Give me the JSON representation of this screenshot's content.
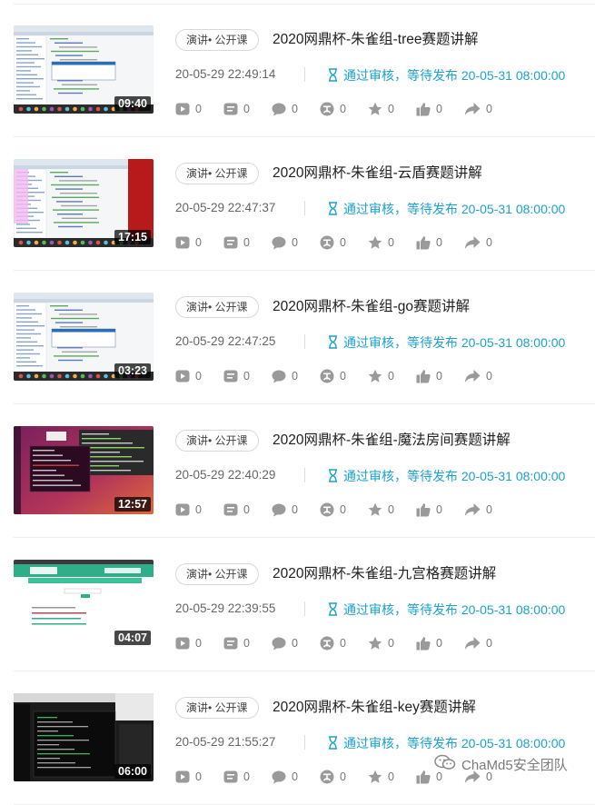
{
  "tag_label": "演讲• 公开课",
  "status_text": "通过审核，等待发布 20-05-31 08:00:00",
  "accent": "#1aa2d0",
  "icons": [
    "play-icon",
    "danmaku-icon",
    "comment-icon",
    "coin-icon",
    "star-icon",
    "like-icon",
    "share-icon"
  ],
  "videos": [
    {
      "title": "2020网鼎杯-朱雀组-tree赛题讲解",
      "time": "20-05-29 22:49:14",
      "duration": "09:40",
      "stats": [
        "0",
        "0",
        "0",
        "0",
        "0",
        "0",
        "0"
      ],
      "thumb_style": "ide-light"
    },
    {
      "title": "2020网鼎杯-朱雀组-云盾赛题讲解",
      "time": "20-05-29 22:47:37",
      "duration": "17:15",
      "stats": [
        "0",
        "0",
        "0",
        "0",
        "0",
        "0",
        "0"
      ],
      "thumb_style": "ide-red"
    },
    {
      "title": "2020网鼎杯-朱雀组-go赛题讲解",
      "time": "20-05-29 22:47:25",
      "duration": "03:23",
      "stats": [
        "0",
        "0",
        "0",
        "0",
        "0",
        "0",
        "0"
      ],
      "thumb_style": "ide-light"
    },
    {
      "title": "2020网鼎杯-朱雀组-魔法房间赛题讲解",
      "time": "20-05-29 22:40:29",
      "duration": "12:57",
      "stats": [
        "0",
        "0",
        "0",
        "0",
        "0",
        "0",
        "0"
      ],
      "thumb_style": "ubuntu"
    },
    {
      "title": "2020网鼎杯-朱雀组-九宫格赛题讲解",
      "time": "20-05-29 22:39:55",
      "duration": "04:07",
      "stats": [
        "0",
        "0",
        "0",
        "0",
        "0",
        "0",
        "0"
      ],
      "thumb_style": "web-green"
    },
    {
      "title": "2020网鼎杯-朱雀组-key赛题讲解",
      "time": "20-05-29 21:55:27",
      "duration": "06:00",
      "stats": [
        "0",
        "0",
        "0",
        "0",
        "0",
        "0",
        "0"
      ],
      "thumb_style": "terminal-dark"
    }
  ],
  "watermark": {
    "text": "ChaMd5安全团队",
    "icon": "wechat-icon"
  }
}
